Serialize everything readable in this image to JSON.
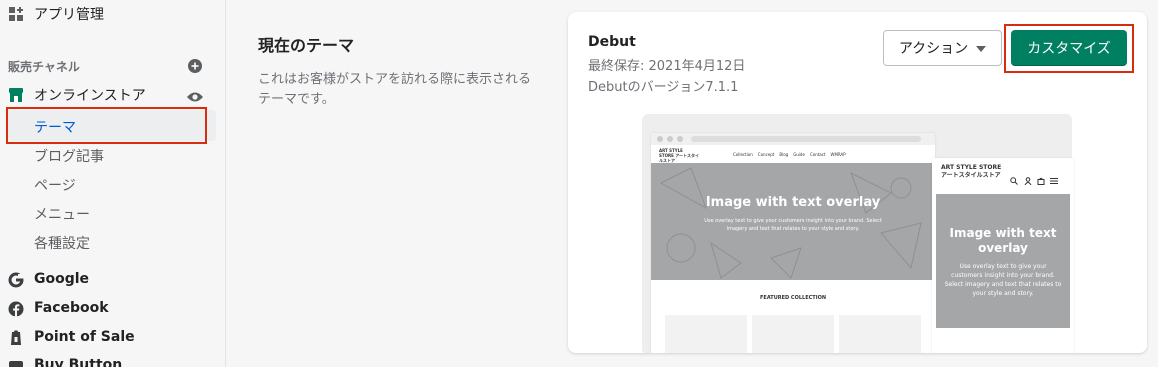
{
  "sidebar": {
    "apps": {
      "label": "アプリ管理",
      "icon": "apps-icon"
    },
    "channels_header": "販売チャネル",
    "add_channel_icon": "plus-circle-icon",
    "online_store": {
      "label": "オンラインストア",
      "icon": "store-icon",
      "view_icon": "eye-icon"
    },
    "subitems": [
      "テーマ",
      "ブログ記事",
      "ページ",
      "メニュー",
      "各種設定"
    ],
    "channels": [
      {
        "label": "Google",
        "icon": "google-icon"
      },
      {
        "label": "Facebook",
        "icon": "facebook-icon"
      },
      {
        "label": "Point of Sale",
        "icon": "pos-icon"
      },
      {
        "label": "Buy Button",
        "icon": "buy-button-icon"
      }
    ]
  },
  "main": {
    "title": "現在のテーマ",
    "description": "これはお客様がストアを訪れる際に表示されるテーマです。"
  },
  "theme": {
    "name": "Debut",
    "last_saved": "最終保存: 2021年4月12日",
    "version": "Debutのバージョン7.1.1",
    "action_label": "アクション",
    "customize_label": "カスタマイズ"
  },
  "preview": {
    "store_name": "ART STYLE STORE アートスタイルストア",
    "nav": [
      "Collection",
      "Concept",
      "Blog",
      "Guide",
      "Contact",
      "WMRAP"
    ],
    "hero_title": "Image with text overlay",
    "hero_sub": "Use overlay text to give your customers insight into your brand. Select imagery and text that relates to your style and story.",
    "featured": "FEATURED COLLECTION",
    "mobile_store_name": "ART STYLE STORE アートスタイルストア"
  }
}
